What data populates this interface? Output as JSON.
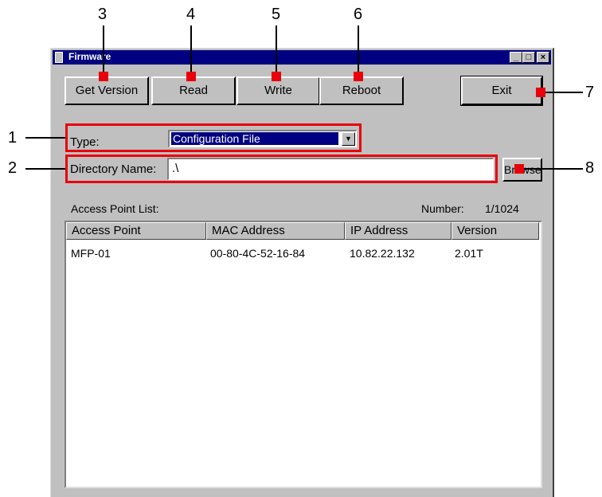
{
  "window": {
    "title": "Firmware",
    "controls": [
      "minimize",
      "maximize",
      "close"
    ]
  },
  "toolbar": {
    "get_version": "Get Version",
    "read": "Read",
    "write": "Write",
    "reboot": "Reboot",
    "exit": "Exit"
  },
  "form": {
    "type_label": "Type:",
    "type_value": "Configuration File",
    "directory_label": "Directory Name:",
    "directory_value": ".\\",
    "browse": "Browse"
  },
  "access_point_list": {
    "label": "Access Point List:",
    "number_label": "Number:",
    "number_value": "1/1024",
    "columns": [
      "Access Point",
      "MAC Address",
      "IP Address",
      "Version"
    ],
    "rows": [
      [
        "MFP-01",
        "00-80-4C-52-16-84",
        "10.82.22.132",
        "2.01T"
      ]
    ]
  },
  "callouts": [
    "1",
    "2",
    "3",
    "4",
    "5",
    "6",
    "7",
    "8"
  ],
  "colors": {
    "callout_red": "#e8000b",
    "title_bar": "#000080",
    "dialog_face": "#c0c0c0"
  }
}
